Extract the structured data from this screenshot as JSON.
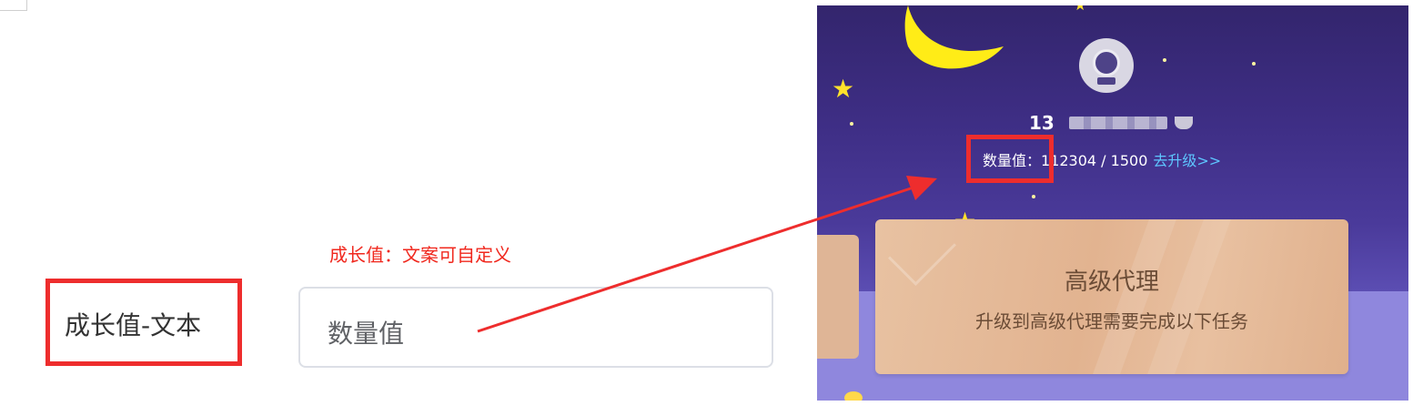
{
  "editor": {
    "annotation_note": "成长值：文案可自定义",
    "field_label": "成长值-文本",
    "field_value": "数量值"
  },
  "preview": {
    "username": "13",
    "growth_label": "数量值：",
    "growth_value": "112304 / 1500",
    "upgrade_link": "去升级>>",
    "card": {
      "title": "高级代理",
      "subtitle": "升级到高级代理需要完成以下任务"
    }
  },
  "colors": {
    "annotation_red": "#ee2d2d",
    "link_blue": "#5ec6ff",
    "card_peach": "#e2b390",
    "sky_purple": "#3e2e85"
  }
}
